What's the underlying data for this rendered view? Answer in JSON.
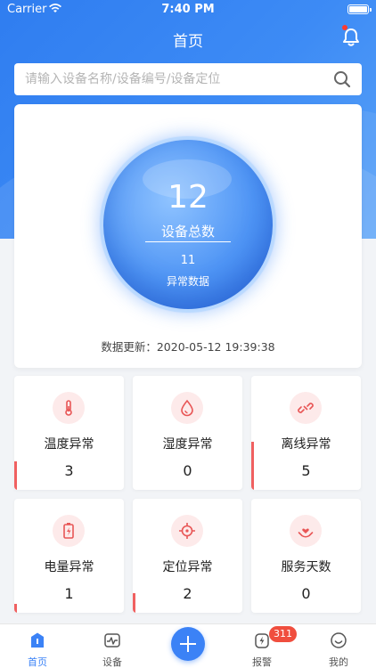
{
  "status_bar": {
    "carrier": "Carrier",
    "time": "7:40 PM"
  },
  "header": {
    "title": "首页",
    "bell_icon": "bell-icon"
  },
  "search": {
    "placeholder": "请输入设备名称/设备编号/设备定位",
    "icon": "search-icon"
  },
  "overview": {
    "device_total": "12",
    "device_total_label": "设备总数",
    "abnormal_count": "11",
    "abnormal_label": "异常数据",
    "update_text": "数据更新：2020-05-12 19:39:38"
  },
  "stats": [
    {
      "label": "温度异常",
      "value": "3",
      "icon": "thermometer-icon",
      "level": 0.25
    },
    {
      "label": "湿度异常",
      "value": "0",
      "icon": "droplet-icon",
      "level": 0
    },
    {
      "label": "离线异常",
      "value": "5",
      "icon": "broken-link-icon",
      "level": 0.42
    },
    {
      "label": "电量异常",
      "value": "1",
      "icon": "battery-charging-icon",
      "level": 0.08
    },
    {
      "label": "定位异常",
      "value": "2",
      "icon": "crosshair-icon",
      "level": 0.17
    },
    {
      "label": "服务天数",
      "value": "0",
      "icon": "hand-heart-icon",
      "level": 0
    }
  ],
  "colors": {
    "primary": "#3b82f6",
    "alert": "#f06060",
    "badge": "#f04e3e"
  },
  "tabbar": {
    "home": "首页",
    "devices": "设备",
    "alarm": "报警",
    "alarm_badge": "311",
    "mine": "我的"
  }
}
